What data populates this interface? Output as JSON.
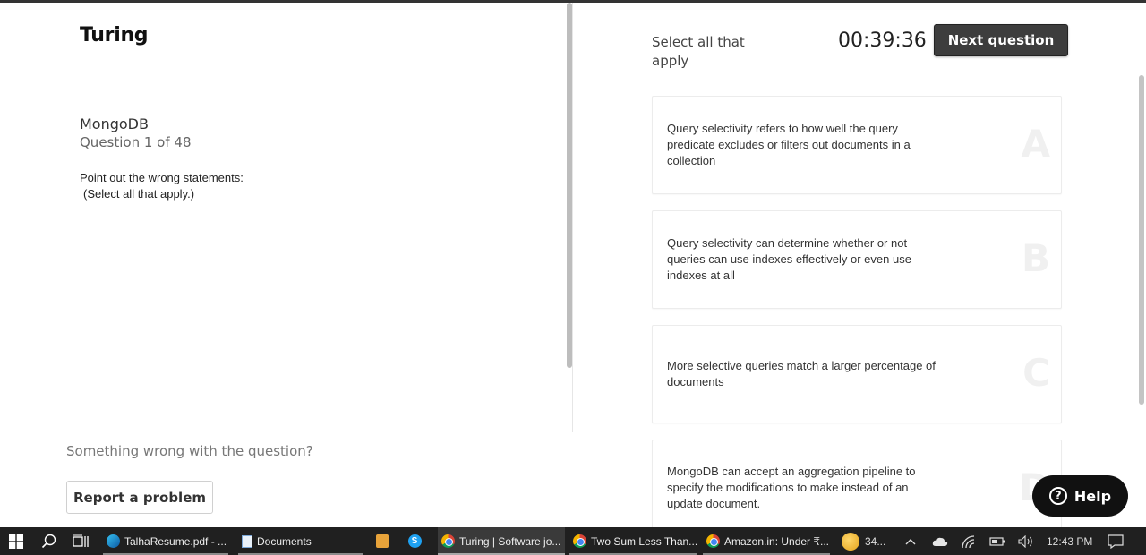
{
  "brand": "Turing",
  "question": {
    "subject": "MongoDB",
    "number_label": "Question 1 of 48",
    "prompt_line1": "Point out the wrong statements:",
    "prompt_line2": "(Select all that apply.)"
  },
  "report": {
    "prompt": "Something wrong with the question?",
    "button_label": "Report a problem"
  },
  "header": {
    "instruction": "Select all that apply",
    "timer": "00:39:36",
    "next_label": "Next question"
  },
  "options": [
    {
      "letter": "A",
      "text": "Query selectivity refers to how well the query predicate excludes or filters out documents in a collection"
    },
    {
      "letter": "B",
      "text": "Query selectivity can determine whether or not queries can use indexes effectively or even use indexes at all"
    },
    {
      "letter": "C",
      "text": "More selective queries match a larger percentage of documents"
    },
    {
      "letter": "D",
      "text": "MongoDB can accept an aggregation pipeline to specify the modifications to make instead of an update document."
    }
  ],
  "help": {
    "label": "Help",
    "glyph": "?"
  },
  "taskbar": {
    "apps": [
      {
        "label": "TalhaResume.pdf - ...",
        "icon": "edge-icon"
      },
      {
        "label": "Documents",
        "icon": "notepad-icon"
      },
      {
        "label": "",
        "icon": "sublime-icon"
      },
      {
        "label": "",
        "icon": "skype-icon"
      },
      {
        "label": "Turing | Software jo...",
        "icon": "chrome-icon"
      },
      {
        "label": "Two Sum Less Than...",
        "icon": "chrome-icon"
      },
      {
        "label": "Amazon.in: Under ₹...",
        "icon": "chrome-icon"
      }
    ],
    "weather": "34...",
    "clock": "12:43 PM"
  },
  "colors": {
    "primary_button": "#3d3d3d",
    "help_button": "#111111",
    "taskbar": "#202020"
  }
}
